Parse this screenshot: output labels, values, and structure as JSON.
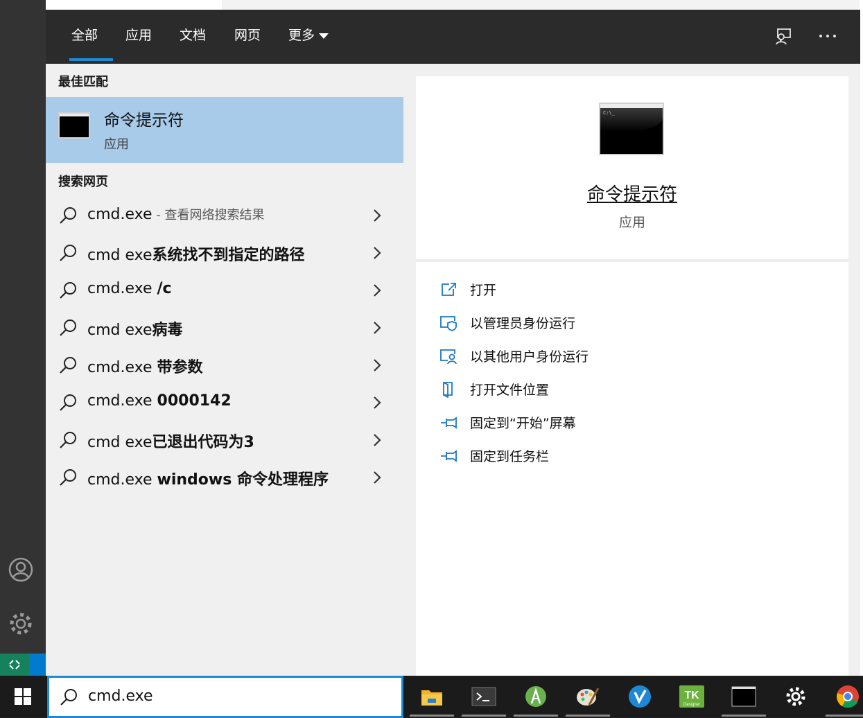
{
  "tabs": [
    {
      "label": "全部",
      "active": true
    },
    {
      "label": "应用",
      "active": false
    },
    {
      "label": "文档",
      "active": false
    },
    {
      "label": "网页",
      "active": false
    },
    {
      "label": "更多",
      "active": false
    }
  ],
  "header_icons": [
    "feedback-icon",
    "more-options-icon"
  ],
  "best_match": {
    "section_title": "最佳匹配",
    "title": "命令提示符",
    "subtitle": "应用"
  },
  "web_search": {
    "section_title": "搜索网页",
    "rows": [
      {
        "prefix": "cmd.exe",
        "bold": "",
        "hint": " - 查看网络搜索结果"
      },
      {
        "prefix": "cmd exe",
        "bold": "系统找不到指定的路径",
        "hint": ""
      },
      {
        "prefix": "cmd.exe ",
        "bold": "/c",
        "hint": ""
      },
      {
        "prefix": "cmd exe",
        "bold": "病毒",
        "hint": ""
      },
      {
        "prefix": "cmd.exe ",
        "bold": "带参数",
        "hint": ""
      },
      {
        "prefix": "cmd.exe ",
        "bold": "0000142",
        "hint": ""
      },
      {
        "prefix": "cmd exe",
        "bold": "已退出代码为3",
        "hint": ""
      },
      {
        "prefix": "cmd.exe ",
        "bold": "windows 命令处理程序",
        "hint": ""
      }
    ]
  },
  "preview": {
    "title": "命令提示符",
    "subtitle": "应用",
    "thumb_text": "C:\\_",
    "actions": [
      {
        "label": "打开",
        "icon": "open-icon"
      },
      {
        "label": "以管理员身份运行",
        "icon": "run-as-admin-icon"
      },
      {
        "label": "以其他用户身份运行",
        "icon": "run-as-other-user-icon"
      },
      {
        "label": "打开文件位置",
        "icon": "open-file-location-icon"
      },
      {
        "label": "固定到“开始”屏幕",
        "icon": "pin-icon"
      },
      {
        "label": "固定到任务栏",
        "icon": "pin-icon"
      }
    ]
  },
  "search": {
    "query": "cmd.exe"
  },
  "taskbar_apps": [
    "file-explorer-icon",
    "terminal-icon",
    "android-studio-icon",
    "paint-icon",
    "vlc-v-icon",
    "tk-designer-icon",
    "cmd-icon",
    "settings-icon",
    "chrome-icon"
  ],
  "taskbar_tk_label": "TK",
  "taskbar_tk_sub": "Designer",
  "colors": {
    "accent": "#1a8ad4",
    "selected_bg": "#a8cbea",
    "header_bg": "#2b2b2b",
    "panel_bg": "#f0f0f0"
  }
}
